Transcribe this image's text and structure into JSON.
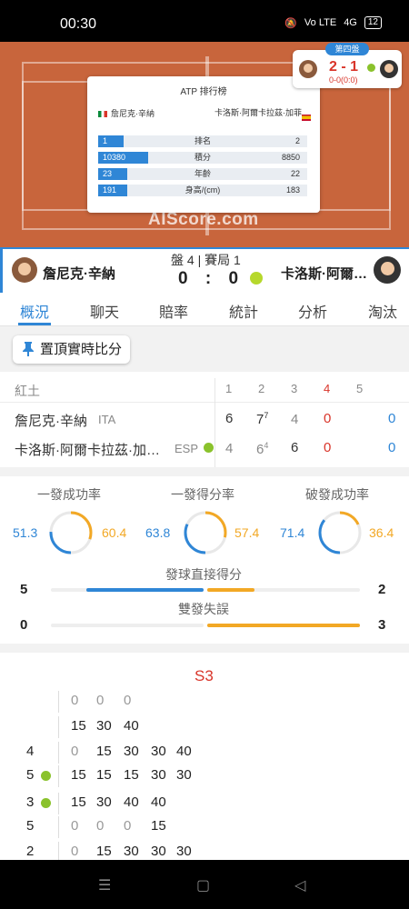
{
  "status": {
    "time": "00:30",
    "net": "Vo LTE",
    "signal": "4G",
    "battery": "12"
  },
  "ranking": {
    "title": "ATP 排行榜",
    "player1": "詹尼克·辛納",
    "player2": "卡洛斯·阿爾卡拉茲·加菲",
    "rows": [
      {
        "label": "排名",
        "p1": "1",
        "p2": "2",
        "p1_fill": 0.12
      },
      {
        "label": "積分",
        "p1": "10380",
        "p2": "8850",
        "p1_fill": 0.24
      },
      {
        "label": "年齡",
        "p1": "23",
        "p2": "22",
        "p1_fill": 0.14
      },
      {
        "label": "身高/(cm)",
        "p1": "191",
        "p2": "183",
        "p1_fill": 0.14
      }
    ]
  },
  "watermark": "AIScore.com",
  "topscore": {
    "set_badge": "第四盤",
    "sets": "2 - 1",
    "game_pts": "0-0(0:0)"
  },
  "match": {
    "player1": "詹尼克·辛納",
    "player2": "卡洛斯·阿爾…",
    "set_info": "盤 4 | 賽局 1",
    "p1_score": "0",
    "sep": ":",
    "p2_score": "0"
  },
  "tabs": [
    "概況",
    "聊天",
    "賠率",
    "統計",
    "分析",
    "淘汰賽"
  ],
  "pin_label": "置頂實時比分",
  "scoreboard": {
    "surface": "紅土",
    "set_headers": [
      "1",
      "2",
      "3",
      "4",
      "5"
    ],
    "rows": [
      {
        "name": "詹尼克·辛納",
        "country": "ITA",
        "s1": "6",
        "s2": "7",
        "s2_tb": "7",
        "s3": "4",
        "s4": "0",
        "total": "0"
      },
      {
        "name": "卡洛斯·阿爾卡拉茲·加…",
        "country": "ESP",
        "s1": "4",
        "s2": "6",
        "s2_tb": "4",
        "s3": "6",
        "s4": "0",
        "total": "0"
      }
    ]
  },
  "stats": {
    "first_serve_pct": {
      "label": "一發成功率",
      "p1": "51.3",
      "p2": "60.4",
      "p1_val": 51.3,
      "p2_val": 60.4
    },
    "first_serve_won": {
      "label": "一發得分率",
      "p1": "63.8",
      "p2": "57.4",
      "p1_val": 63.8,
      "p2_val": 57.4
    },
    "break_conv": {
      "label": "破發成功率",
      "p1": "71.4",
      "p2": "36.4",
      "p1_val": 71.4,
      "p2_val": 36.4
    },
    "aces": {
      "label": "發球直接得分",
      "p1": "5",
      "p2": "2",
      "p1_val": 5,
      "p2_val": 2
    },
    "double_faults": {
      "label": "雙發失誤",
      "p1": "0",
      "p2": "3",
      "p1_val": 0,
      "p2_val": 3
    },
    "colors": {
      "p1": "#2f86d6",
      "p2": "#f2a825"
    }
  },
  "pbp": {
    "set_title": "S3",
    "rows": [
      {
        "game": "",
        "serve": false,
        "points": [
          "0",
          "0",
          "0"
        ]
      },
      {
        "game": "",
        "serve": false,
        "points": [
          "15",
          "30",
          "40"
        ]
      },
      {
        "game": "4",
        "serve": false,
        "points": [
          "0",
          "15",
          "30",
          "30",
          "40"
        ]
      },
      {
        "game": "5",
        "serve": true,
        "points": [
          "15",
          "15",
          "15",
          "30",
          "30"
        ]
      },
      {
        "game": "3",
        "serve": true,
        "points": [
          "15",
          "30",
          "40",
          "40"
        ]
      },
      {
        "game": "5",
        "serve": false,
        "points": [
          "0",
          "0",
          "0",
          "15"
        ]
      },
      {
        "game": "2",
        "serve": false,
        "points": [
          "0",
          "15",
          "30",
          "30",
          "30"
        ]
      }
    ]
  }
}
